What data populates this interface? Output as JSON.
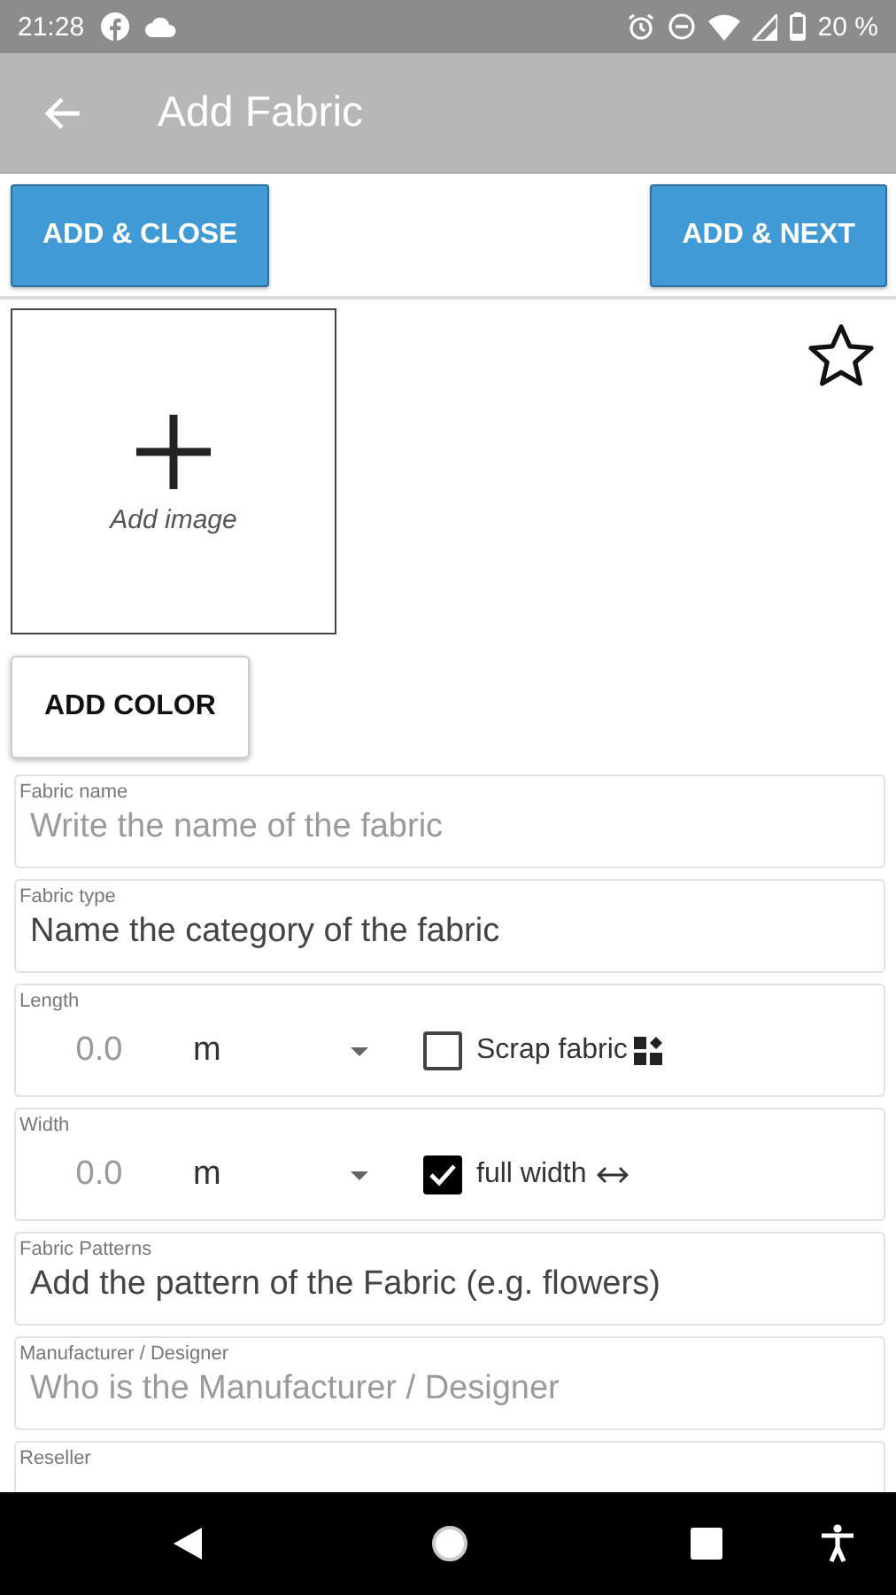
{
  "status_bar": {
    "time": "21:28",
    "battery": "20 %"
  },
  "app_bar": {
    "title": "Add Fabric"
  },
  "actions": [
    {
      "label": "ADD & CLOSE"
    },
    {
      "label": "ADD & NEXT"
    }
  ],
  "image": {
    "label": "Add image"
  },
  "favorite": {
    "selected": false
  },
  "add_color": {
    "label": "ADD COLOR"
  },
  "fields": [
    {
      "kind": "text",
      "label": "Fabric name",
      "placeholder": "Write the name of the fabric"
    },
    {
      "kind": "text",
      "label": "Fabric type",
      "value": "Name the category of the fabric"
    },
    {
      "kind": "measure",
      "label": "Length",
      "placeholder": "0.0",
      "unit": "m",
      "option": {
        "label": "Scrap fabric",
        "checked": false
      }
    },
    {
      "kind": "measure",
      "label": "Width",
      "placeholder": "0.0",
      "unit": "m",
      "option": {
        "label": "full width",
        "checked": true
      }
    },
    {
      "kind": "text",
      "label": "Fabric Patterns",
      "value": "Add the pattern of the Fabric (e.g. flowers)"
    },
    {
      "kind": "text",
      "label": "Manufacturer / Designer",
      "placeholder": "Who is the Manufacturer / Designer"
    },
    {
      "kind": "text",
      "label": "Reseller"
    }
  ]
}
